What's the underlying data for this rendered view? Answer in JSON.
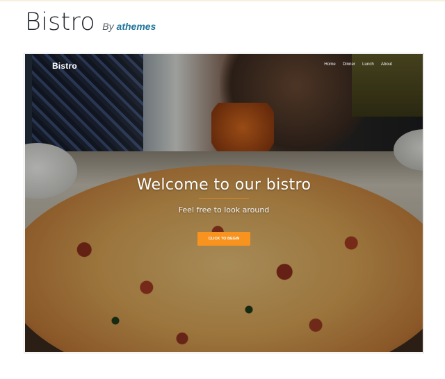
{
  "theme": {
    "name": "Bistro",
    "by_label": "By",
    "author": "athemes"
  },
  "preview": {
    "logo": "Bistro",
    "nav": [
      "Home",
      "Dinner",
      "Lunch",
      "About"
    ],
    "hero": {
      "title": "Welcome to our bistro",
      "subtitle": "Feel free to look around",
      "cta": "CLICK TO BEGIN"
    }
  },
  "colors": {
    "accent": "#f7931e",
    "author_link": "#21759b",
    "title": "#23282d"
  }
}
